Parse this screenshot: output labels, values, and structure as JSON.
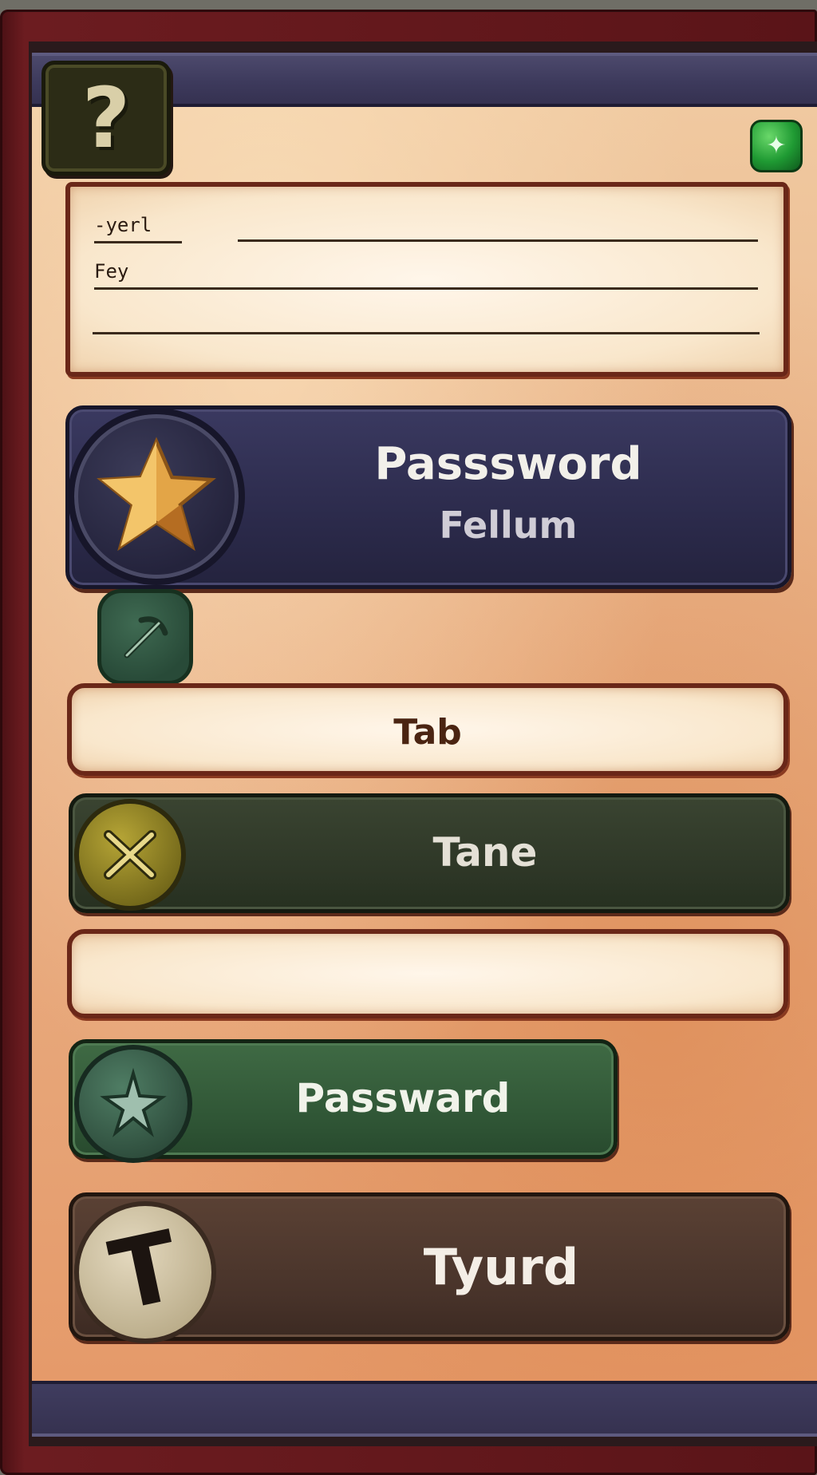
{
  "header": {
    "help_icon_glyph": "?",
    "map_gem_glyph": "✦"
  },
  "notes": {
    "line1_label": "-yerl",
    "line2_label": "Fey"
  },
  "password_card": {
    "title": "Passsword",
    "subtitle": "Fellum"
  },
  "tab_field": {
    "label": "Tab"
  },
  "tane_button": {
    "label": "Tane"
  },
  "passward_button": {
    "label": "Passward"
  },
  "tyurd_button": {
    "label": "Tyurd",
    "icon_glyph": "T"
  },
  "colors": {
    "frame": "#5a1418",
    "parchment": "#eab48a",
    "navy_plate": "#2c2b4c",
    "dark_green_plate": "#2d3626",
    "green_plate": "#2f5535",
    "brown_plate": "#48332a",
    "gold_star": "#e0a040"
  }
}
